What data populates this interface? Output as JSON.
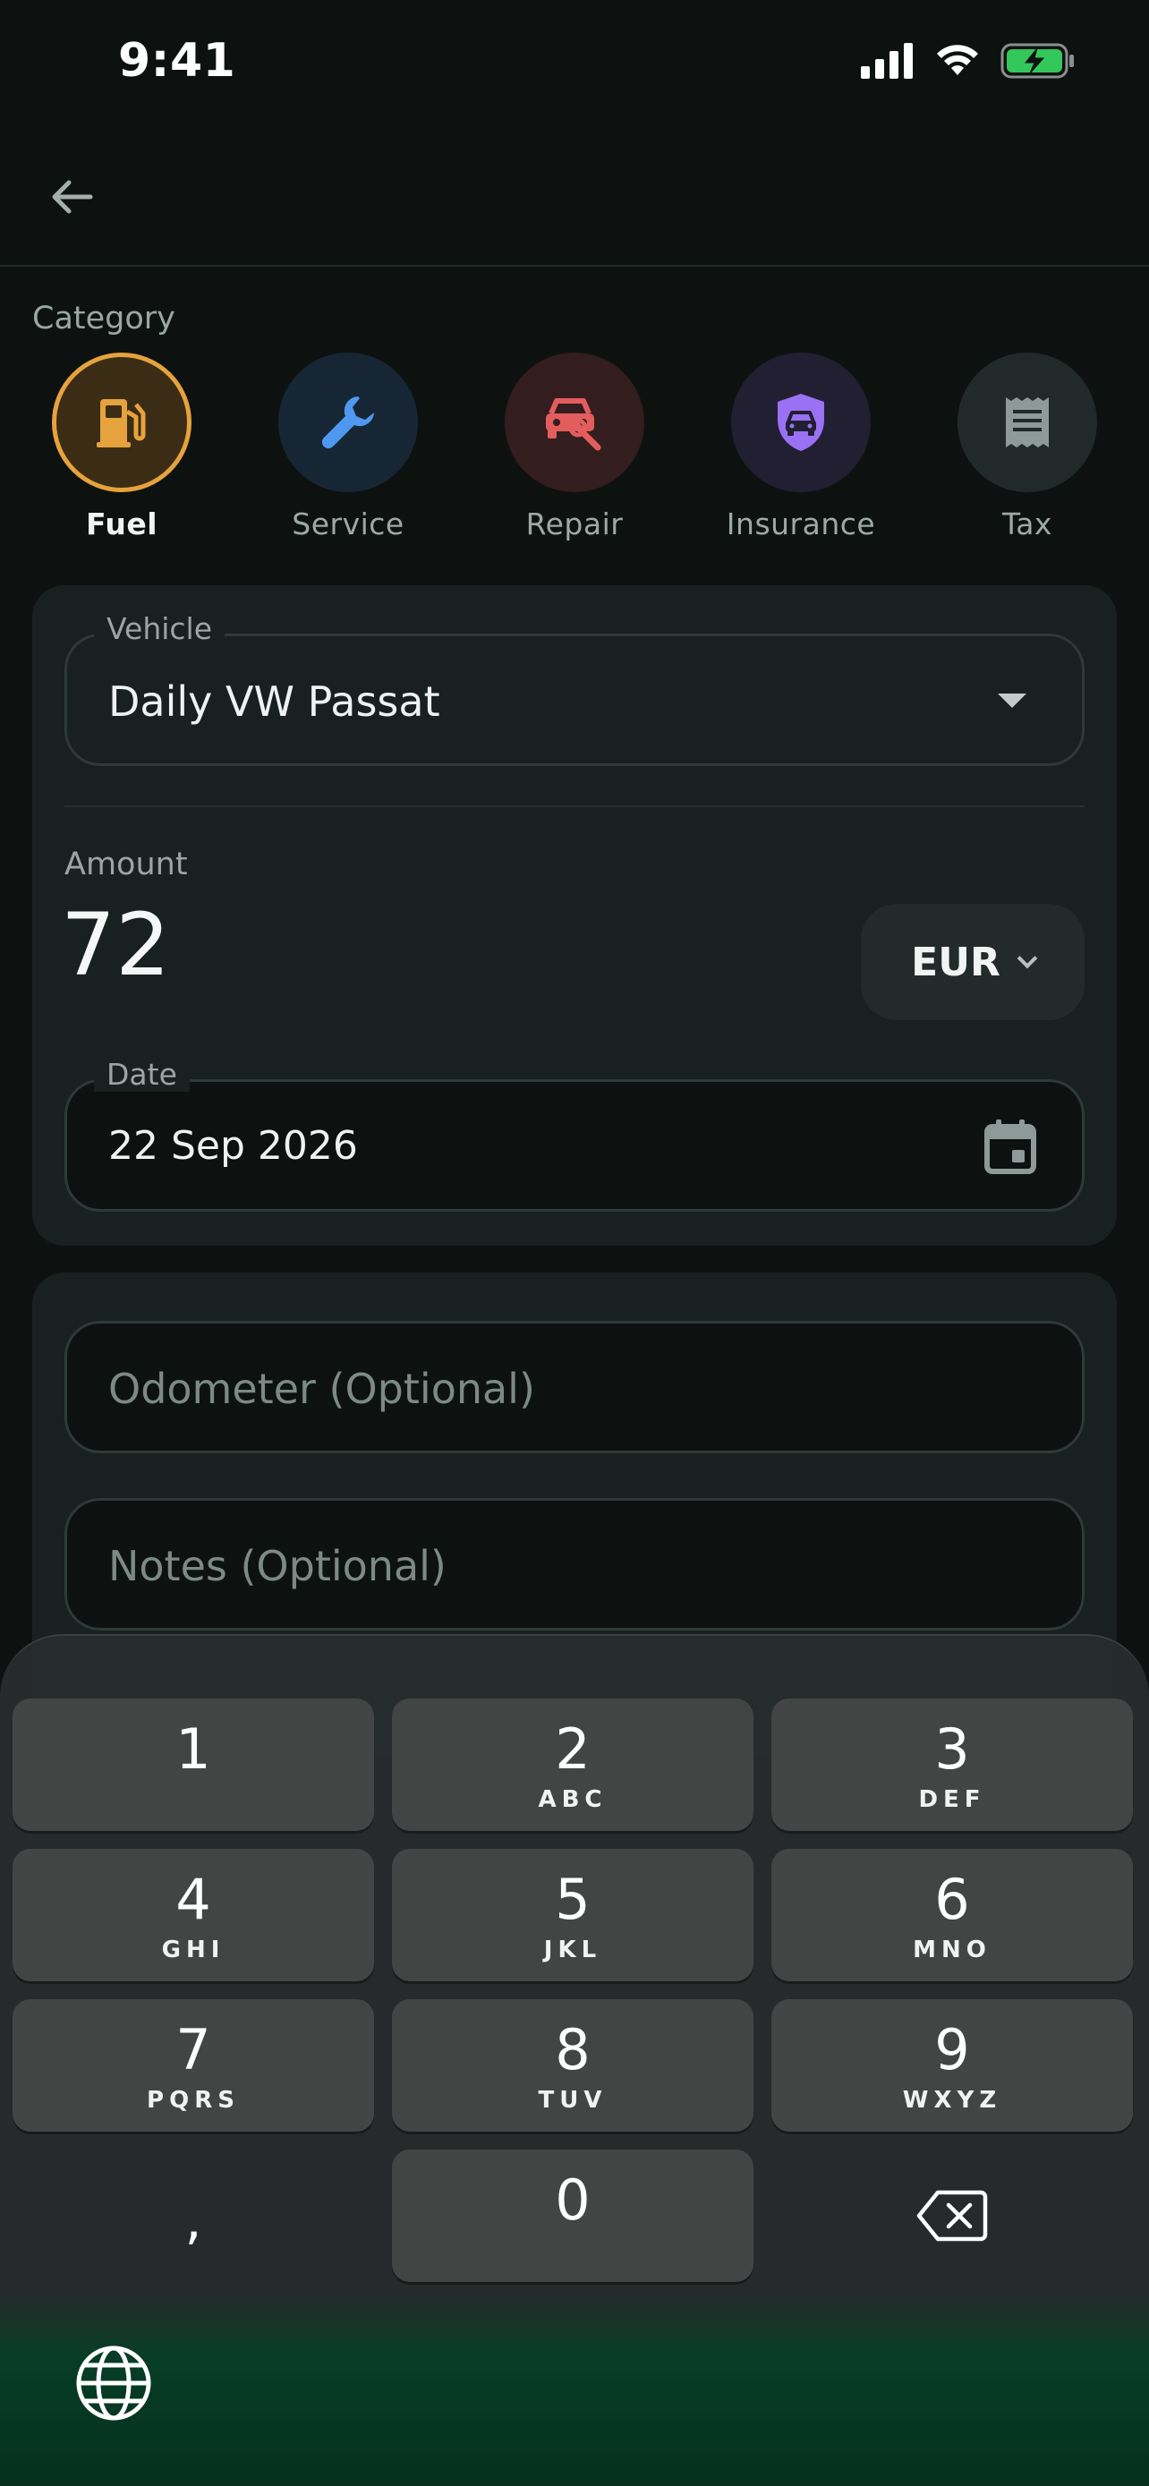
{
  "status_bar": {
    "time": "9:41"
  },
  "category": {
    "label": "Category",
    "items": [
      {
        "name": "Fuel",
        "icon": "fuel-pump-icon",
        "color": "#e6a23c",
        "bg": "#3b2c15",
        "selected": true
      },
      {
        "name": "Service",
        "icon": "wrench-icon",
        "color": "#4e98f2",
        "bg": "#172634",
        "selected": false
      },
      {
        "name": "Repair",
        "icon": "car-repair-icon",
        "color": "#e35d5d",
        "bg": "#341d1e",
        "selected": false
      },
      {
        "name": "Insurance",
        "icon": "shield-car-icon",
        "color": "#9a71f3",
        "bg": "#221f33",
        "selected": false
      },
      {
        "name": "Tax",
        "icon": "receipt-icon",
        "color": "#8e9a97",
        "bg": "#222a29",
        "selected": false
      }
    ]
  },
  "form": {
    "vehicle": {
      "label": "Vehicle",
      "value": "Daily VW Passat"
    },
    "amount": {
      "label": "Amount",
      "value": "72",
      "currency": "EUR"
    },
    "date": {
      "label": "Date",
      "value": "22 Sep 2026"
    },
    "odometer": {
      "placeholder": "Odometer (Optional)"
    },
    "notes": {
      "placeholder": "Notes (Optional)"
    }
  },
  "keyboard": {
    "keys": [
      {
        "num": "1",
        "letters": ""
      },
      {
        "num": "2",
        "letters": "ABC"
      },
      {
        "num": "3",
        "letters": "DEF"
      },
      {
        "num": "4",
        "letters": "GHI"
      },
      {
        "num": "5",
        "letters": "JKL"
      },
      {
        "num": "6",
        "letters": "MNO"
      },
      {
        "num": "7",
        "letters": "PQRS"
      },
      {
        "num": "8",
        "letters": "TUV"
      },
      {
        "num": "9",
        "letters": "WXYZ"
      },
      {
        "num": "0",
        "letters": ""
      }
    ],
    "comma": ","
  },
  "colors": {
    "accent": "#e6a23c",
    "background": "#0d1211",
    "card": "#182020"
  }
}
